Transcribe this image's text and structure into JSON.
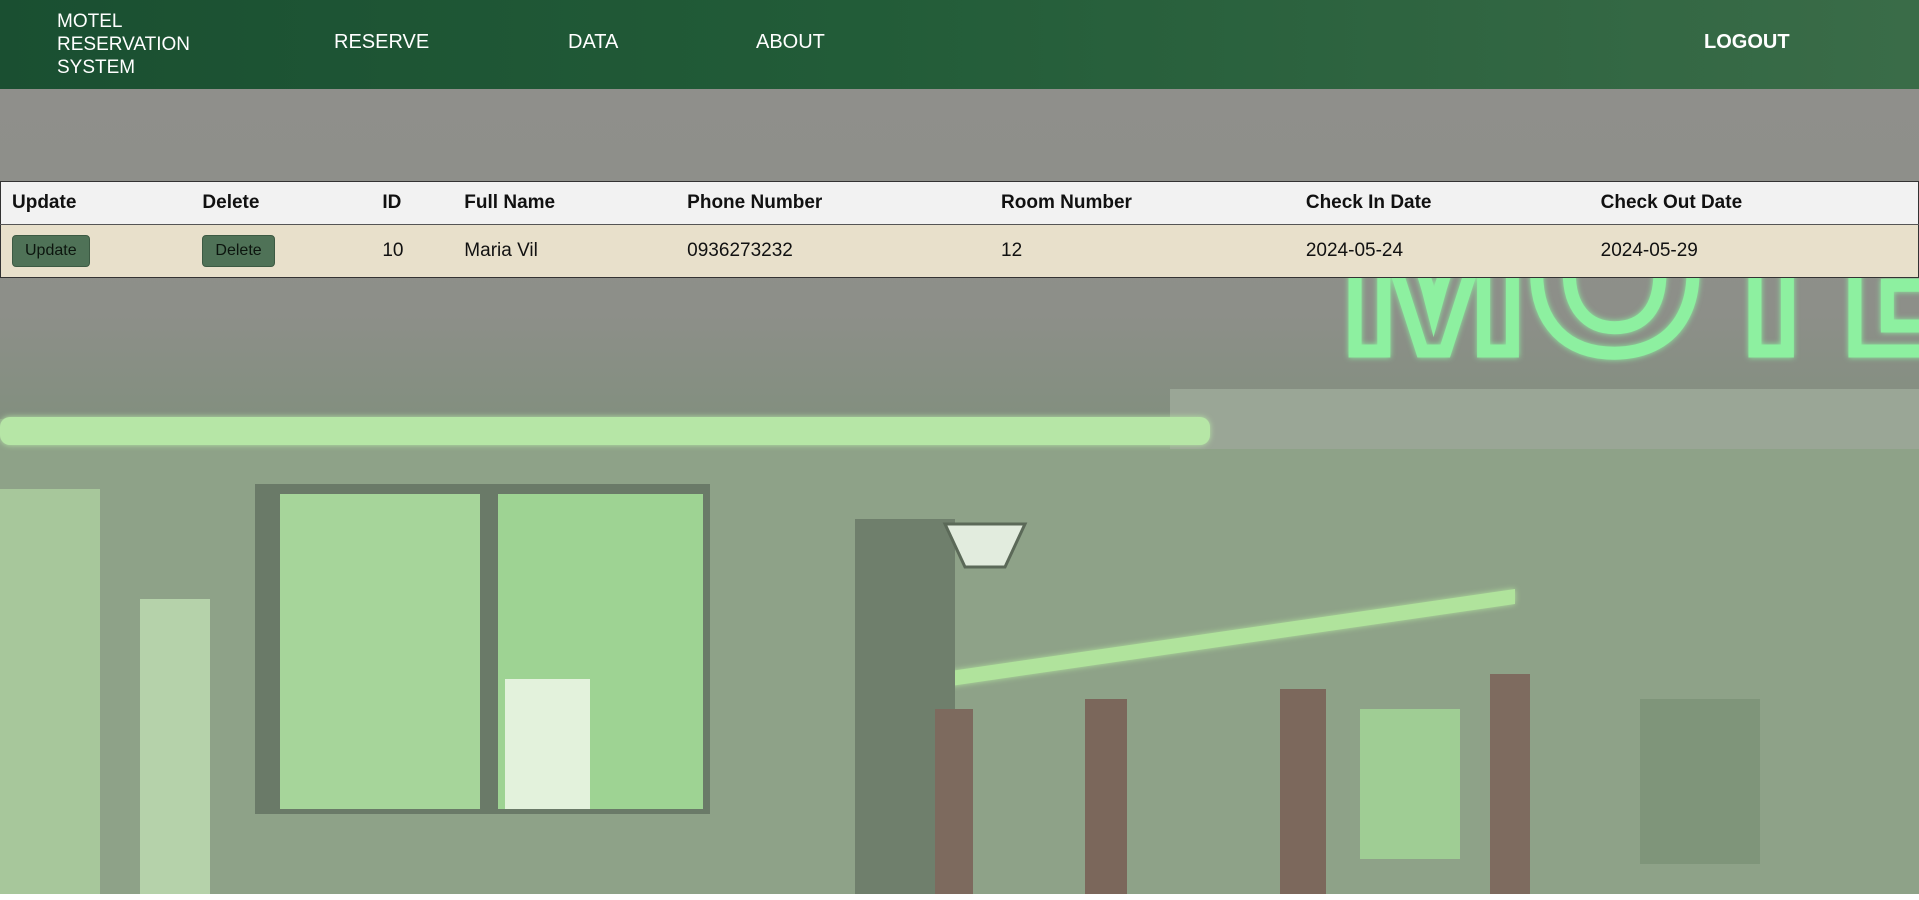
{
  "nav": {
    "brand_lines": [
      "MOTEL",
      "RESERVATION",
      "SYSTEM"
    ],
    "links": [
      "RESERVE",
      "DATA",
      "ABOUT"
    ],
    "logout": "LOGOUT"
  },
  "hero": {
    "sign_text": "MOTEL",
    "theme_color": "#1a4f31",
    "neon_color": "#7be08f"
  },
  "table": {
    "headers": [
      "Update",
      "Delete",
      "ID",
      "Full Name",
      "Phone Number",
      "Room Number",
      "Check In Date",
      "Check Out Date"
    ],
    "rows": [
      {
        "update_label": "Update",
        "delete_label": "Delete",
        "id": "10",
        "full_name": "Maria Vil",
        "phone": "0936273232",
        "room": "12",
        "check_in": "2024-05-24",
        "check_out": "2024-05-29"
      }
    ]
  }
}
